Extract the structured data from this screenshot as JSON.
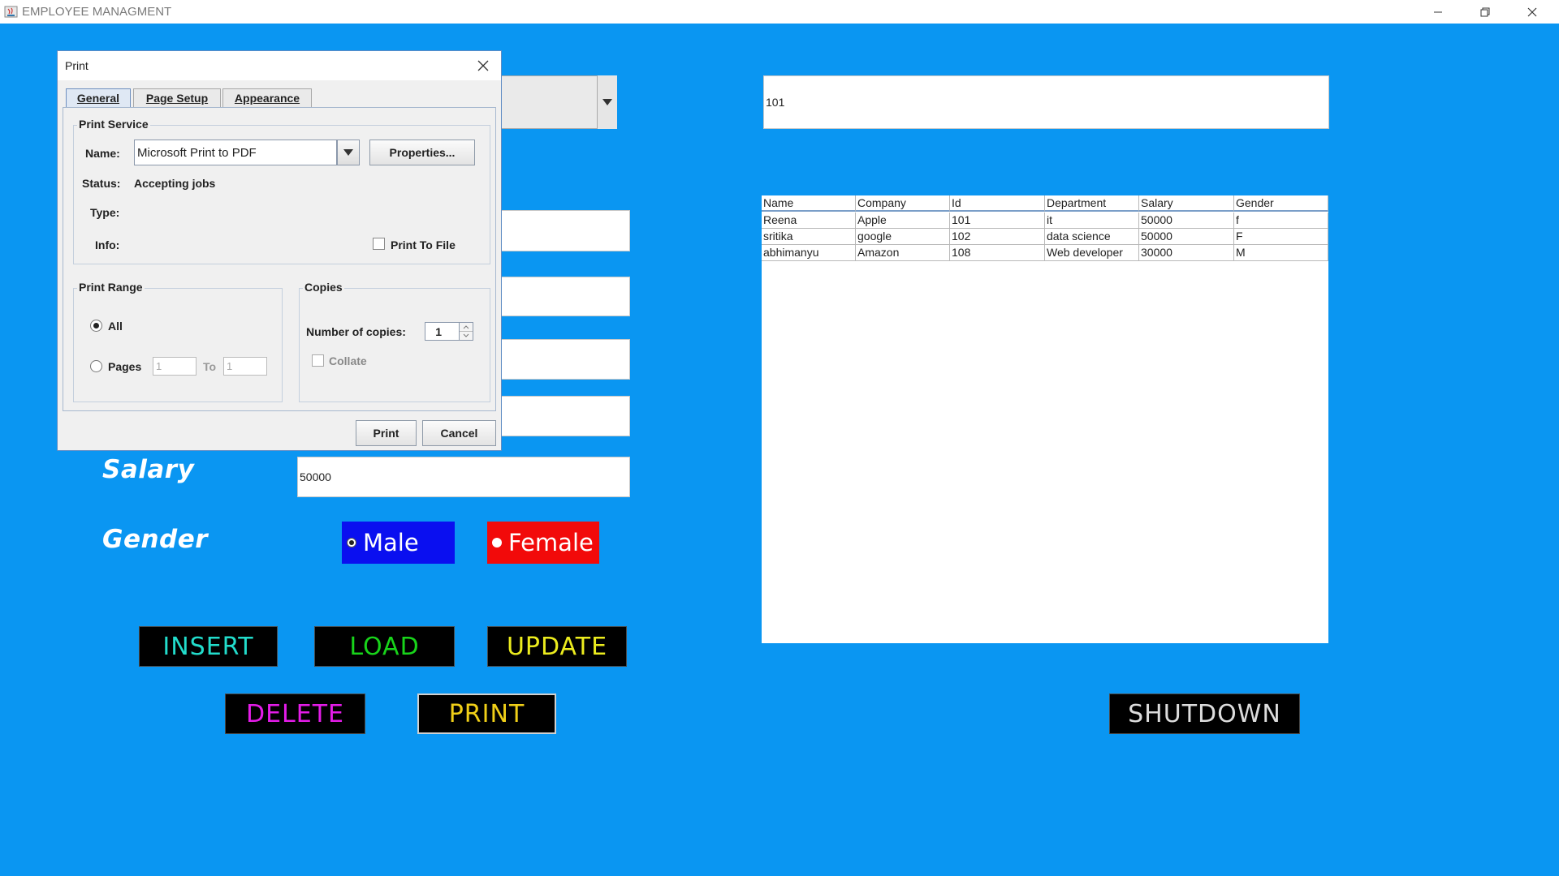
{
  "window": {
    "title": "EMPLOYEE MANAGMENT",
    "minimize_icon": "minimize-icon",
    "restore_icon": "restore-icon",
    "close_icon": "close-icon"
  },
  "form": {
    "id_value": "101",
    "salary_label": "Salary",
    "salary_value": "50000",
    "gender_label": "Gender",
    "gender_male": "Male",
    "gender_female": "Female",
    "gender_selected": "Male"
  },
  "buttons": {
    "insert": "INSERT",
    "load": "LOAD",
    "update": "UPDATE",
    "delete": "DELETE",
    "print": "PRINT",
    "shutdown": "SHUTDOWN"
  },
  "colors": {
    "background": "#0a96f2",
    "male_bg": "#0a0ff0",
    "female_bg": "#f20a0a",
    "insert_text": "#22dccb",
    "load_text": "#18d41a",
    "update_text": "#ecec1e",
    "delete_text": "#e41ce8",
    "print_text": "#f0cf18",
    "shutdown_text": "#dcdcdc"
  },
  "table": {
    "columns": [
      "Name",
      "Company",
      "Id",
      "Department",
      "Salary",
      "Gender"
    ],
    "rows": [
      [
        "Reena",
        "Apple",
        "101",
        "it",
        "50000",
        "f"
      ],
      [
        "sritika",
        "google",
        "102",
        "data science",
        "50000",
        "F"
      ],
      [
        "abhimanyu",
        "Amazon",
        "108",
        "Web developer",
        "30000",
        "M"
      ]
    ]
  },
  "print_dialog": {
    "title": "Print",
    "tabs": [
      "General",
      "Page Setup",
      "Appearance"
    ],
    "active_tab": "General",
    "print_service": {
      "group_title": "Print Service",
      "name_label": "Name:",
      "name_value": "Microsoft Print to PDF",
      "properties_button": "Properties...",
      "status_label": "Status:",
      "status_value": "Accepting jobs",
      "type_label": "Type:",
      "info_label": "Info:",
      "print_to_file_label": "Print To File",
      "print_to_file_checked": false
    },
    "print_range": {
      "group_title": "Print Range",
      "all_label": "All",
      "pages_label": "Pages",
      "to_label": "To",
      "from_value": "1",
      "to_value": "1",
      "selected": "All"
    },
    "copies": {
      "group_title": "Copies",
      "number_label": "Number of copies:",
      "number_value": "1",
      "collate_label": "Collate",
      "collate_checked": false
    },
    "print_button": "Print",
    "cancel_button": "Cancel"
  }
}
